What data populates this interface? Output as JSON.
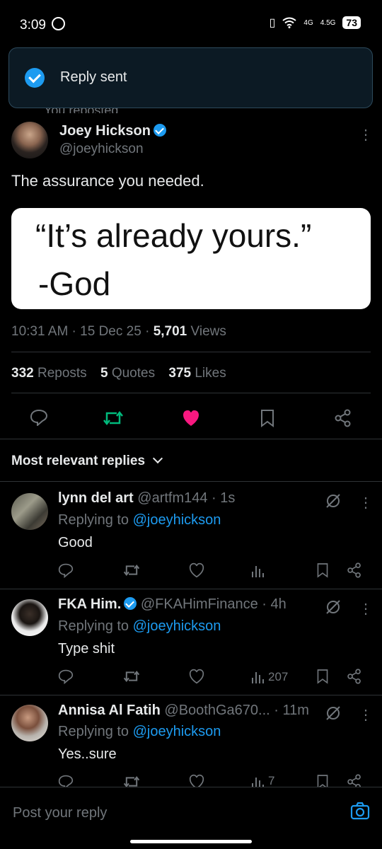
{
  "status": {
    "time": "3:09",
    "network1": "4G",
    "network2": "4.5G",
    "battery": "73"
  },
  "toast": {
    "text": "Reply sent"
  },
  "reposted": {
    "text": "You reposted"
  },
  "tweet": {
    "author": "Joey Hickson",
    "handle": "@joeyhickson",
    "text": "The assurance you needed.",
    "quote_line1": "“It’s already yours.”",
    "quote_line2": "-God",
    "time": "10:31 AM",
    "date": "15 Dec 25",
    "views_count": "5,701",
    "views_label": "Views",
    "reposts_count": "332",
    "reposts_label": "Reposts",
    "quotes_count": "5",
    "quotes_label": "Quotes",
    "likes_count": "375",
    "likes_label": "Likes"
  },
  "sort": {
    "label": "Most relevant replies"
  },
  "replies": [
    {
      "name": "lynn del art",
      "verified": false,
      "handle": "@artfm144",
      "time": "1s",
      "replying_to": "Replying to",
      "mention": "@joeyhickson",
      "text": "Good",
      "views": ""
    },
    {
      "name": "FKA Him.",
      "verified": true,
      "handle": "@FKAHimFinance",
      "time": "4h",
      "replying_to": "Replying to",
      "mention": "@joeyhickson",
      "text": "Type shit",
      "views": "207"
    },
    {
      "name": "Annisa Al Fatih",
      "verified": false,
      "handle": "@BoothGa670...",
      "time": "11m",
      "replying_to": "Replying to",
      "mention": "@joeyhickson",
      "text": "Yes..sure",
      "views": "7"
    }
  ],
  "composer": {
    "placeholder": "Post your reply"
  },
  "colors": {
    "accent": "#1d9bf0",
    "like": "#f91880",
    "repost": "#00ba7c",
    "background": "#000000"
  }
}
